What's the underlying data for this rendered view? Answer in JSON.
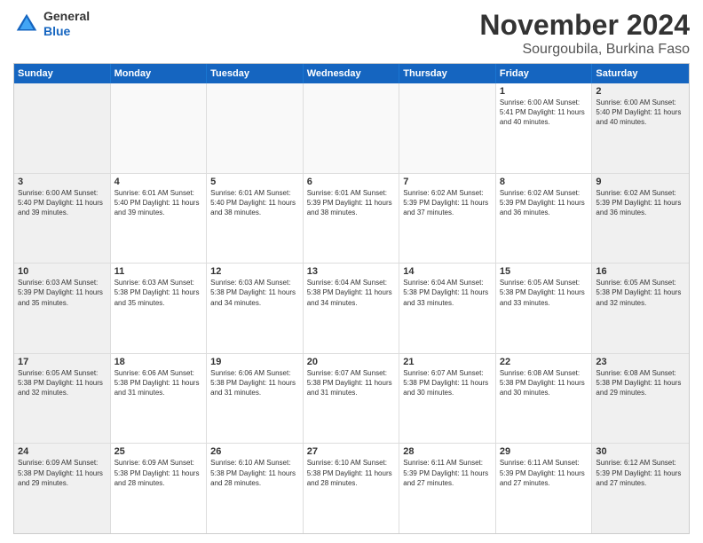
{
  "logo": {
    "general": "General",
    "blue": "Blue"
  },
  "title": "November 2024",
  "location": "Sourgoubila, Burkina Faso",
  "header_days": [
    "Sunday",
    "Monday",
    "Tuesday",
    "Wednesday",
    "Thursday",
    "Friday",
    "Saturday"
  ],
  "weeks": [
    [
      {
        "day": "",
        "info": ""
      },
      {
        "day": "",
        "info": ""
      },
      {
        "day": "",
        "info": ""
      },
      {
        "day": "",
        "info": ""
      },
      {
        "day": "",
        "info": ""
      },
      {
        "day": "1",
        "info": "Sunrise: 6:00 AM\nSunset: 5:41 PM\nDaylight: 11 hours and 40 minutes."
      },
      {
        "day": "2",
        "info": "Sunrise: 6:00 AM\nSunset: 5:40 PM\nDaylight: 11 hours and 40 minutes."
      }
    ],
    [
      {
        "day": "3",
        "info": "Sunrise: 6:00 AM\nSunset: 5:40 PM\nDaylight: 11 hours and 39 minutes."
      },
      {
        "day": "4",
        "info": "Sunrise: 6:01 AM\nSunset: 5:40 PM\nDaylight: 11 hours and 39 minutes."
      },
      {
        "day": "5",
        "info": "Sunrise: 6:01 AM\nSunset: 5:40 PM\nDaylight: 11 hours and 38 minutes."
      },
      {
        "day": "6",
        "info": "Sunrise: 6:01 AM\nSunset: 5:39 PM\nDaylight: 11 hours and 38 minutes."
      },
      {
        "day": "7",
        "info": "Sunrise: 6:02 AM\nSunset: 5:39 PM\nDaylight: 11 hours and 37 minutes."
      },
      {
        "day": "8",
        "info": "Sunrise: 6:02 AM\nSunset: 5:39 PM\nDaylight: 11 hours and 36 minutes."
      },
      {
        "day": "9",
        "info": "Sunrise: 6:02 AM\nSunset: 5:39 PM\nDaylight: 11 hours and 36 minutes."
      }
    ],
    [
      {
        "day": "10",
        "info": "Sunrise: 6:03 AM\nSunset: 5:39 PM\nDaylight: 11 hours and 35 minutes."
      },
      {
        "day": "11",
        "info": "Sunrise: 6:03 AM\nSunset: 5:38 PM\nDaylight: 11 hours and 35 minutes."
      },
      {
        "day": "12",
        "info": "Sunrise: 6:03 AM\nSunset: 5:38 PM\nDaylight: 11 hours and 34 minutes."
      },
      {
        "day": "13",
        "info": "Sunrise: 6:04 AM\nSunset: 5:38 PM\nDaylight: 11 hours and 34 minutes."
      },
      {
        "day": "14",
        "info": "Sunrise: 6:04 AM\nSunset: 5:38 PM\nDaylight: 11 hours and 33 minutes."
      },
      {
        "day": "15",
        "info": "Sunrise: 6:05 AM\nSunset: 5:38 PM\nDaylight: 11 hours and 33 minutes."
      },
      {
        "day": "16",
        "info": "Sunrise: 6:05 AM\nSunset: 5:38 PM\nDaylight: 11 hours and 32 minutes."
      }
    ],
    [
      {
        "day": "17",
        "info": "Sunrise: 6:05 AM\nSunset: 5:38 PM\nDaylight: 11 hours and 32 minutes."
      },
      {
        "day": "18",
        "info": "Sunrise: 6:06 AM\nSunset: 5:38 PM\nDaylight: 11 hours and 31 minutes."
      },
      {
        "day": "19",
        "info": "Sunrise: 6:06 AM\nSunset: 5:38 PM\nDaylight: 11 hours and 31 minutes."
      },
      {
        "day": "20",
        "info": "Sunrise: 6:07 AM\nSunset: 5:38 PM\nDaylight: 11 hours and 31 minutes."
      },
      {
        "day": "21",
        "info": "Sunrise: 6:07 AM\nSunset: 5:38 PM\nDaylight: 11 hours and 30 minutes."
      },
      {
        "day": "22",
        "info": "Sunrise: 6:08 AM\nSunset: 5:38 PM\nDaylight: 11 hours and 30 minutes."
      },
      {
        "day": "23",
        "info": "Sunrise: 6:08 AM\nSunset: 5:38 PM\nDaylight: 11 hours and 29 minutes."
      }
    ],
    [
      {
        "day": "24",
        "info": "Sunrise: 6:09 AM\nSunset: 5:38 PM\nDaylight: 11 hours and 29 minutes."
      },
      {
        "day": "25",
        "info": "Sunrise: 6:09 AM\nSunset: 5:38 PM\nDaylight: 11 hours and 28 minutes."
      },
      {
        "day": "26",
        "info": "Sunrise: 6:10 AM\nSunset: 5:38 PM\nDaylight: 11 hours and 28 minutes."
      },
      {
        "day": "27",
        "info": "Sunrise: 6:10 AM\nSunset: 5:38 PM\nDaylight: 11 hours and 28 minutes."
      },
      {
        "day": "28",
        "info": "Sunrise: 6:11 AM\nSunset: 5:39 PM\nDaylight: 11 hours and 27 minutes."
      },
      {
        "day": "29",
        "info": "Sunrise: 6:11 AM\nSunset: 5:39 PM\nDaylight: 11 hours and 27 minutes."
      },
      {
        "day": "30",
        "info": "Sunrise: 6:12 AM\nSunset: 5:39 PM\nDaylight: 11 hours and 27 minutes."
      }
    ]
  ]
}
